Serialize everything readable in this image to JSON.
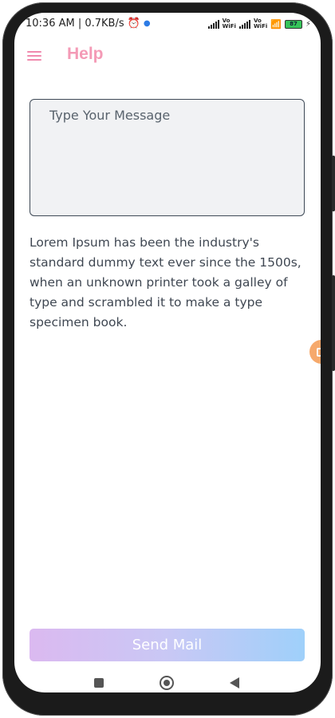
{
  "status_bar": {
    "time_speed": "10:36 AM | 0.7KB/s",
    "battery": "87",
    "vo_top": "Vo",
    "wifi_bottom": "WiFi"
  },
  "app_bar": {
    "title": "Help",
    "menu_icon": "hamburger-menu-icon"
  },
  "form": {
    "message_placeholder": "Type Your Message",
    "message_value": ""
  },
  "body_text": "Lorem Ipsum has been the industry's standard dummy text ever since the 1500s, when an unknown printer took a galley of type and scrambled it to make a type specimen book.",
  "send_button_label": "Send Mail",
  "colors": {
    "accent": "#f49ab6",
    "gradient_start": "#dbb9f0",
    "gradient_end": "#9fd0fa"
  }
}
